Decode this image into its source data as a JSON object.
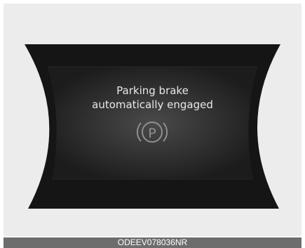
{
  "display": {
    "message_line1": "Parking brake",
    "message_line2": "automatically engaged",
    "indicator_symbol": "P",
    "indicator_icon": "parking-brake-icon"
  },
  "figure": {
    "code": "ODEEV078036NR"
  },
  "colors": {
    "background": "#ececec",
    "panel": "#141414",
    "text": "#e8e8e8",
    "footer": "#6d6d6d"
  }
}
